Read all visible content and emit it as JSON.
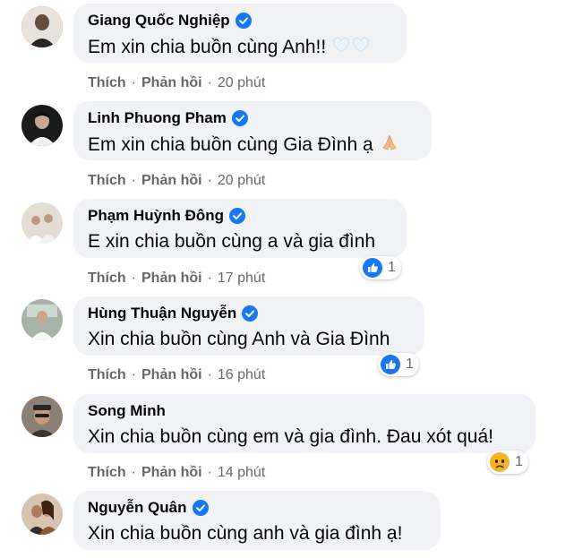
{
  "actions": {
    "like": "Thích",
    "reply": "Phản hồi"
  },
  "comments": [
    {
      "name": "Giang Quốc Nghiệp",
      "text": "Em xin chia buồn cùng Anh!!",
      "emoji": "🤍🤍",
      "time": "20 phút",
      "reaction": null,
      "avatar_color": "#3a2a24"
    },
    {
      "name": "Linh Phuong Pham",
      "text": "Em xin chia buồn cùng Gia Đình ạ",
      "emoji": "🙏",
      "time": "20 phút",
      "reaction": null,
      "avatar_color": "#1c1c1c"
    },
    {
      "name": "Phạm Huỳnh Đông",
      "text": "E xin chia buồn cùng a và gia đình",
      "emoji": "",
      "time": "17 phút",
      "reaction": {
        "type": "like-icon",
        "count": "1"
      },
      "avatar_color": "#c9b9a8"
    },
    {
      "name": "Hùng Thuận Nguyễn",
      "text": "Xin chia buồn cùng Anh và Gia Đình",
      "emoji": "",
      "time": "16 phút",
      "reaction": {
        "type": "like-icon",
        "count": "1"
      },
      "avatar_color": "#9aa49a"
    },
    {
      "name": "Song Minh",
      "text": "Xin chia buồn cùng em và gia đình. Đau xót quá!",
      "emoji": "",
      "time": "14 phút",
      "reaction": {
        "type": "sad-icon",
        "count": "1"
      },
      "avatar_color": "#4a4038"
    },
    {
      "name": "Nguyễn Quân",
      "text": "Xin chia buồn cùng anh và gia đình ạ!",
      "emoji": "",
      "time": "",
      "reaction": null,
      "avatar_color": "#8a5a3e"
    }
  ],
  "colors": {
    "verified": "#1877f2",
    "like": "#1877f2",
    "sad": "#f7b125",
    "bubble": "#f0f2f5",
    "meta": "#65676b"
  }
}
